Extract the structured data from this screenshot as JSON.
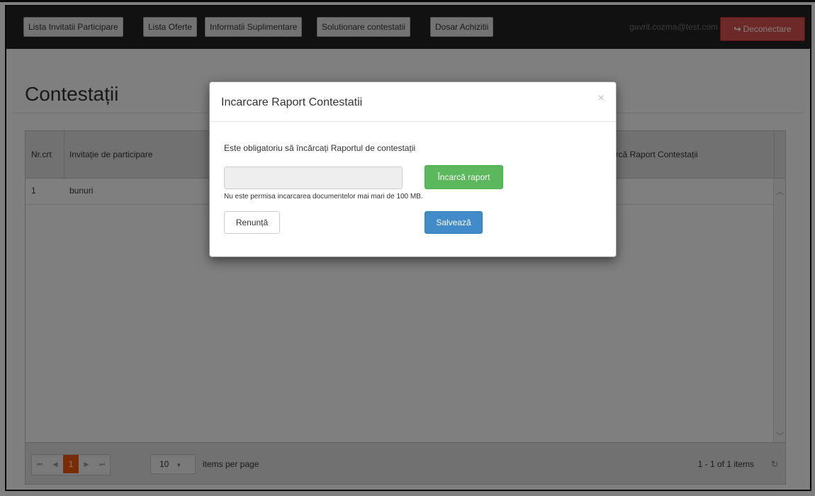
{
  "navbar": {
    "buttons": [
      "Lista Invitatii Participare",
      "Lista Oferte",
      "Informatii Suplimentare",
      "Solutionare contestatii",
      "Dosar Achizitii"
    ],
    "user_email": "gavril.cozma@test.com",
    "logout_label": "Deconectare",
    "logout_icon": "sign-out-icon"
  },
  "page": {
    "title": "Contestații"
  },
  "grid": {
    "columns": [
      "Nr.crt",
      "Invitație de participare",
      "arcă Raport Contestații"
    ],
    "rows": [
      {
        "nr": "1",
        "invitatie": "bunuri"
      }
    ],
    "pager": {
      "current_page": "1",
      "page_size": "10",
      "items_per_page_label": "items per page",
      "info": "1 - 1 of 1 items"
    }
  },
  "modal": {
    "title": "Incarcare Raport Contestatii",
    "close": "×",
    "message": "Este obligatoriu să încărcați Raportul de contestații",
    "file_value": "",
    "upload_label": "Încarcă raport",
    "hint": "Nu este permisa incarcarea documentelor mai mari de 100 MB.",
    "cancel_label": "Renunță",
    "save_label": "Salvează"
  },
  "colors": {
    "navbar_bg": "#222222",
    "logout": "#d9534f",
    "upload": "#5cb85c",
    "save": "#428bca",
    "pager_active": "#f35800"
  }
}
